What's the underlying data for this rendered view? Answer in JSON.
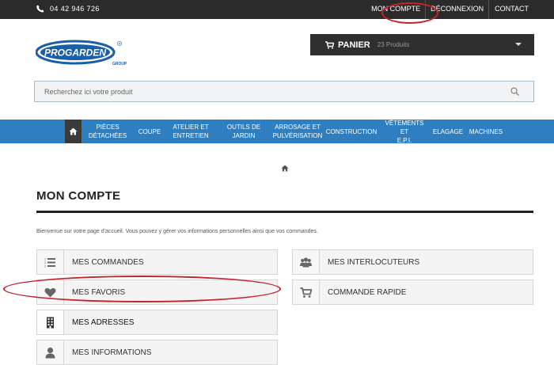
{
  "topbar": {
    "phone": "04 42 946 726",
    "links": [
      "MON COMPTE",
      "DÉCONNEXION",
      "CONTACT"
    ]
  },
  "brand": {
    "logo_text": "PROGARDEN",
    "logo_sub": "GROUP"
  },
  "cart": {
    "label": "PANIER",
    "count": "23 Produits"
  },
  "search": {
    "placeholder": "Recherchez ici votre produit"
  },
  "nav": {
    "items": [
      [
        "PIÈCES",
        "DÉTACHÉES"
      ],
      [
        "COUPE"
      ],
      [
        "ATELIER ET",
        "ENTRETIEN"
      ],
      [
        "OUTILS DE",
        "JARDIN"
      ],
      [
        "ARROSAGE ET",
        "PULVÉRISATION"
      ],
      [
        "CONSTRUCTION"
      ],
      [
        "VÊTEMENTS ET",
        "E.P.I."
      ],
      [
        "ELAGAGE"
      ],
      [
        "MACHINES"
      ]
    ]
  },
  "page": {
    "title": "MON COMPTE",
    "welcome": "Bienvenue sur votre page d'accueil. Vous pouvez y gérer vos informations personnelles ainsi que vos commandes."
  },
  "account": {
    "left": [
      {
        "label": "MES COMMANDES",
        "icon": "list-icon"
      },
      {
        "label": "MES FAVORIS",
        "icon": "heart-icon"
      },
      {
        "label": "MES ADRESSES",
        "icon": "building-icon"
      },
      {
        "label": "MES INFORMATIONS",
        "icon": "user-icon"
      }
    ],
    "right": [
      {
        "label": "MES INTERLOCUTEURS",
        "icon": "users-icon"
      },
      {
        "label": "COMMANDE RAPIDE",
        "icon": "cart-icon"
      }
    ]
  },
  "colors": {
    "topbar": "#2b2b2b",
    "nav": "#2d7fc1",
    "annotation": "#c4232b",
    "logo_blue": "#1a5fa8"
  }
}
